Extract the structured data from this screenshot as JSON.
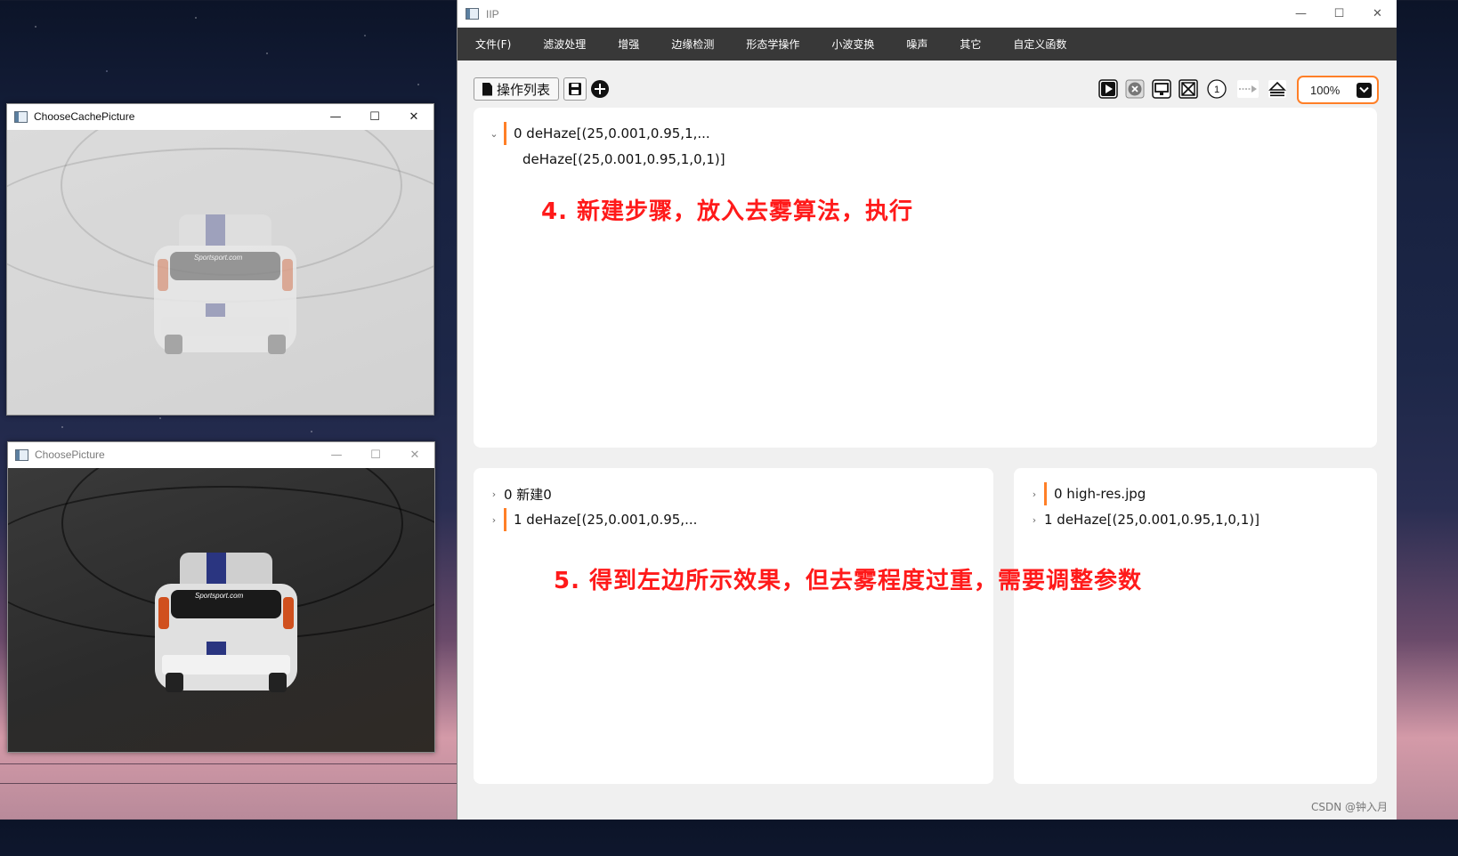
{
  "cache_window": {
    "title": "ChooseCachePicture"
  },
  "picture_window": {
    "title": "ChoosePicture"
  },
  "car_brand_text": "Sportsport.com",
  "main_window": {
    "title": "IIP",
    "menu": [
      "文件(F)",
      "滤波处理",
      "增强",
      "边缘检测",
      "形态学操作",
      "小波变换",
      "噪声",
      "其它",
      "自定义函数"
    ],
    "toolbar": {
      "op_list_label": "操作列表",
      "step_number": "1",
      "zoom": "100%"
    },
    "top_panel": {
      "node_label": "0 deHaze[(25,0.001,0.95,1,...",
      "child_label": "deHaze[(25,0.001,0.95,1,0,1)]",
      "annotation": "4. 新建步骤，放入去雾算法，执行"
    },
    "bottom_left_panel": {
      "items": [
        "0 新建0",
        "1 deHaze[(25,0.001,0.95,..."
      ],
      "annotation": "5. 得到左边所示效果，但去雾程度过重，需要调整参数"
    },
    "bottom_right_panel": {
      "items": [
        "0 high-res.jpg",
        "1 deHaze[(25,0.001,0.95,1,0,1)]"
      ]
    },
    "watermark": "CSDN @钟入月"
  },
  "icons": [
    "app-icon",
    "minimize-icon",
    "maximize-icon",
    "close-icon",
    "document-icon",
    "save-icon",
    "add-icon",
    "play-icon",
    "stop-icon",
    "screen-icon",
    "close-all-icon",
    "step-number-icon",
    "arrow-right-icon",
    "eject-icon",
    "chevron-down-icon"
  ],
  "colors": {
    "accent": "#ff7f27",
    "annotation": "#ff1a1a",
    "menubar": "#383838"
  }
}
